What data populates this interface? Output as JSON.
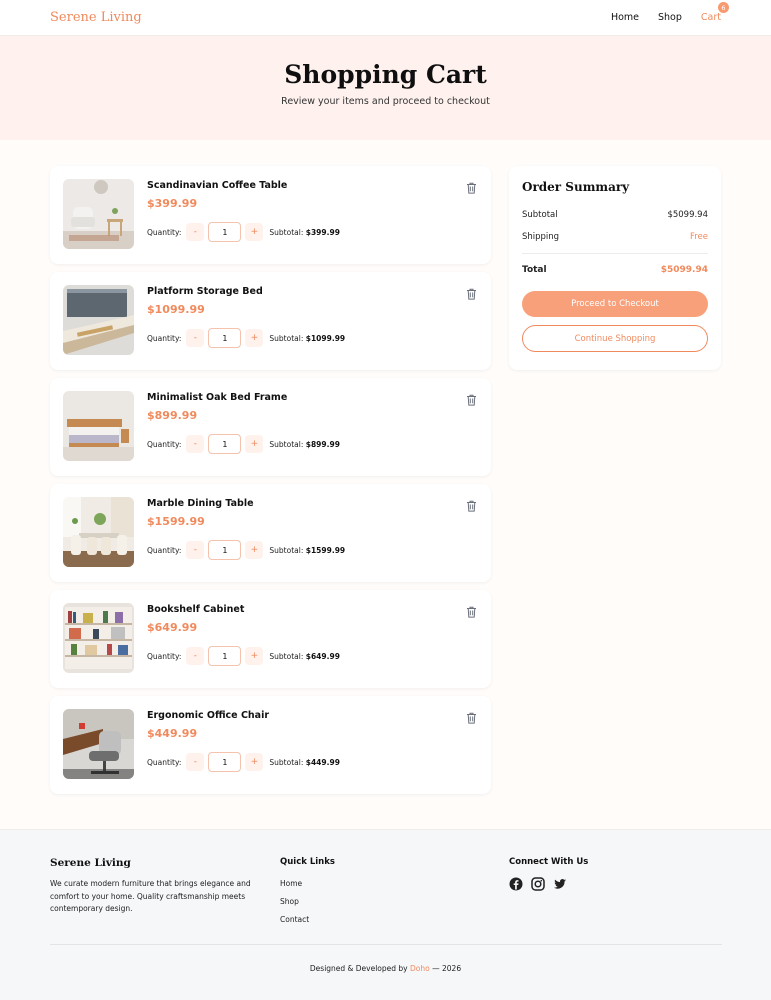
{
  "nav": {
    "brand": "Serene Living",
    "links": [
      "Home",
      "Shop"
    ],
    "cart_label": "Cart",
    "cart_count": "6"
  },
  "hero": {
    "title": "Shopping Cart",
    "subtitle": "Review your items and proceed to checkout"
  },
  "cart": {
    "quantity_label": "Quantity:",
    "subtotal_label": "Subtotal:",
    "minus": "-",
    "plus": "+",
    "items": [
      {
        "name": "Scandinavian Coffee Table",
        "price": "$399.99",
        "qty": "1",
        "subtotal": "$399.99",
        "image": "armchair-room"
      },
      {
        "name": "Platform Storage Bed",
        "price": "$1099.99",
        "qty": "1",
        "subtotal": "$1099.99",
        "image": "platform-steps"
      },
      {
        "name": "Minimalist Oak Bed Frame",
        "price": "$899.99",
        "qty": "1",
        "subtotal": "$899.99",
        "image": "oak-bed"
      },
      {
        "name": "Marble Dining Table",
        "price": "$1599.99",
        "qty": "1",
        "subtotal": "$1599.99",
        "image": "dining-room"
      },
      {
        "name": "Bookshelf Cabinet",
        "price": "$649.99",
        "qty": "1",
        "subtotal": "$649.99",
        "image": "bookshelf"
      },
      {
        "name": "Ergonomic Office Chair",
        "price": "$449.99",
        "qty": "1",
        "subtotal": "$449.99",
        "image": "office-chair"
      }
    ]
  },
  "summary": {
    "title": "Order Summary",
    "subtotal_label": "Subtotal",
    "subtotal_value": "$5099.94",
    "shipping_label": "Shipping",
    "shipping_value": "Free",
    "total_label": "Total",
    "total_value": "$5099.94",
    "checkout_label": "Proceed to Checkout",
    "continue_label": "Continue Shopping"
  },
  "footer": {
    "brand": "Serene Living",
    "description": "We curate modern furniture that brings elegance and comfort to your home. Quality craftsmanship meets contemporary design.",
    "quick_links_title": "Quick Links",
    "quick_links": [
      "Home",
      "Shop",
      "Contact"
    ],
    "connect_title": "Connect With Us",
    "social": [
      "facebook-icon",
      "instagram-icon",
      "twitter-icon"
    ],
    "credit_prefix": "Designed & Developed by",
    "credit_name": "Doho",
    "credit_suffix": "— 2026"
  },
  "colors": {
    "accent": "#f08a5d",
    "hero_bg": "#fff2ee",
    "footer_bg": "#f6f7f9"
  }
}
